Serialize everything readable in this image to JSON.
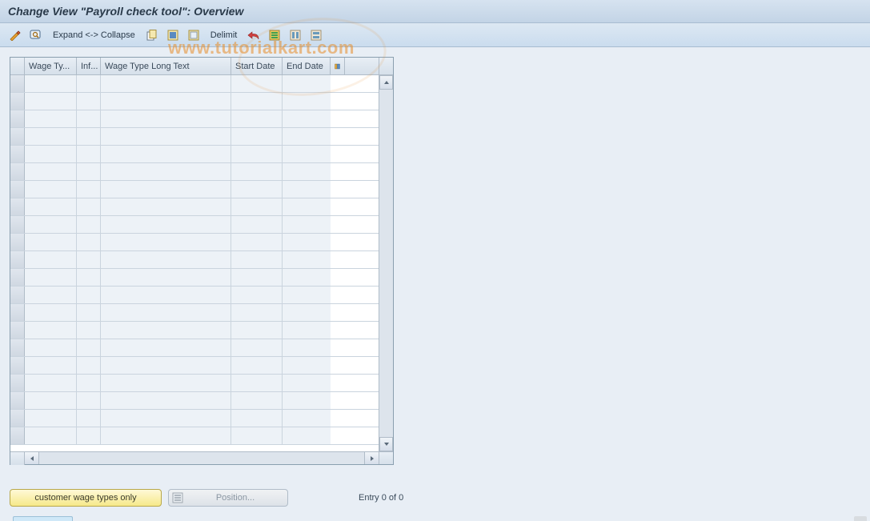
{
  "title": "Change View \"Payroll check tool\": Overview",
  "toolbar": {
    "expand_collapse": "Expand <-> Collapse",
    "delimit": "Delimit"
  },
  "watermark": "www.tutorialkart.com",
  "table": {
    "columns": {
      "wage_type": "Wage Ty...",
      "inf": "Inf...",
      "long_text": "Wage Type Long Text",
      "start_date": "Start Date",
      "end_date": "End Date"
    }
  },
  "bottom": {
    "customer_btn": "customer wage types only",
    "position_btn": "Position...",
    "status": "Entry 0 of 0"
  }
}
